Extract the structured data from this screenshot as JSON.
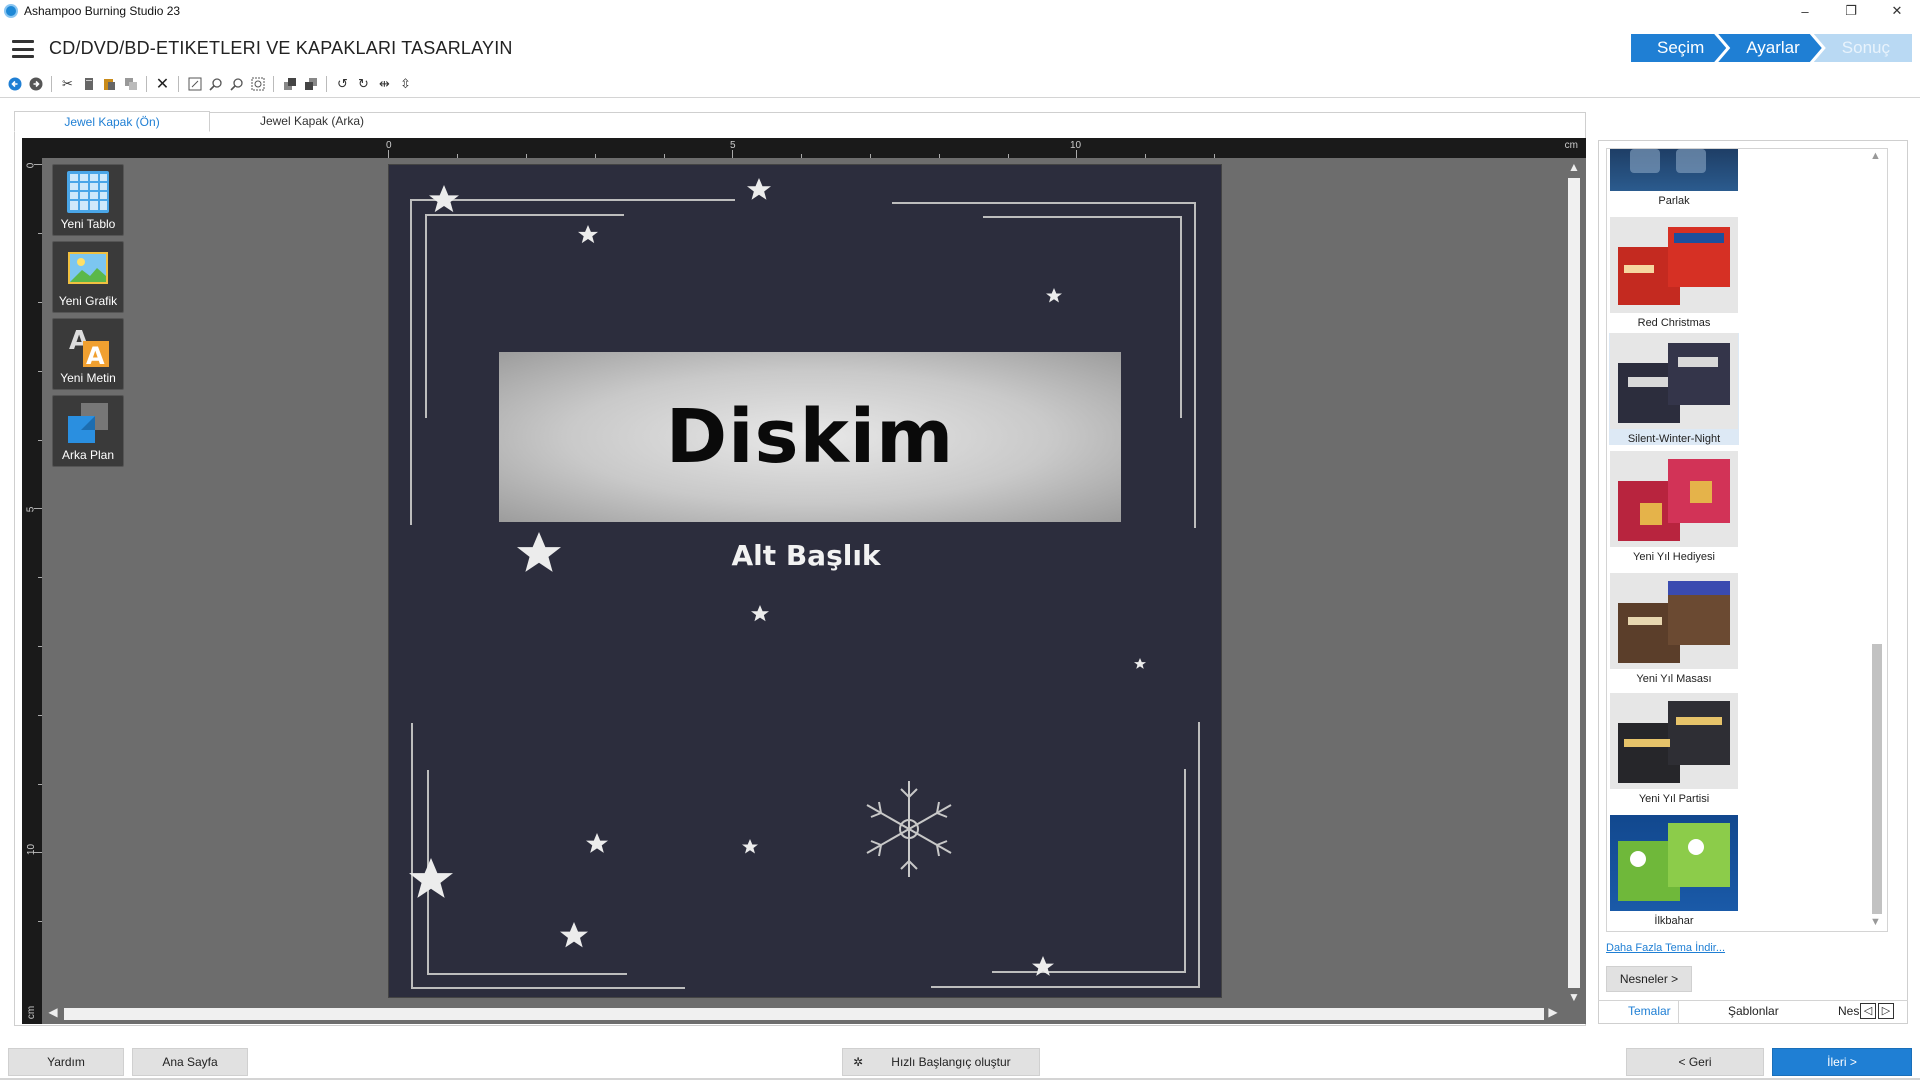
{
  "app": {
    "title": "Ashampoo Burning Studio 23"
  },
  "window_controls": {
    "minimize": "–",
    "restore": "❐",
    "close": "✕"
  },
  "header": {
    "title": "CD/DVD/BD-ETIKETLERI VE KAPAKLARI TASARLAYIN"
  },
  "steps": [
    {
      "label": "Seçim"
    },
    {
      "label": "Ayarlar"
    },
    {
      "label": "Sonuç"
    }
  ],
  "doc_tabs": [
    {
      "label": "Jewel Kapak (Ön)"
    },
    {
      "label": "Jewel Kapak (Arka)"
    }
  ],
  "ruler": {
    "unit": "cm",
    "top_numbers": [
      "0",
      "5",
      "10"
    ],
    "left_numbers": [
      "0",
      "5",
      "10"
    ]
  },
  "tools": [
    {
      "label": "Yeni Tablo",
      "icon": "table-icon"
    },
    {
      "label": "Yeni Grafik",
      "icon": "image-icon"
    },
    {
      "label": "Yeni Metin",
      "icon": "text-icon"
    },
    {
      "label": "Arka Plan",
      "icon": "background-icon"
    }
  ],
  "cover": {
    "title": "Diskim",
    "subtitle": "Alt Başlık"
  },
  "themes": [
    {
      "name": "Parlak"
    },
    {
      "name": "Red Christmas"
    },
    {
      "name": "Silent-Winter-Night",
      "selected": true
    },
    {
      "name": "Yeni Yıl Hediyesi"
    },
    {
      "name": "Yeni Yıl Masası"
    },
    {
      "name": "Yeni Yıl Partisi"
    },
    {
      "name": "İlkbahar"
    }
  ],
  "right_panel": {
    "more_link": "Daha Fazla Tema İndir...",
    "objects_button": "Nesneler >",
    "tabs": [
      "Temalar",
      "Şablonlar",
      "Nes"
    ]
  },
  "bottom": {
    "help": "Yardım",
    "home": "Ana Sayfa",
    "quickstart": "Hızlı Başlangıç oluştur",
    "back": "< Geri",
    "next": "İleri >"
  },
  "colors": {
    "accent": "#1f7fd4",
    "cover_bg": "#2c2d3d",
    "canvas_bg": "#6d6d6d"
  }
}
